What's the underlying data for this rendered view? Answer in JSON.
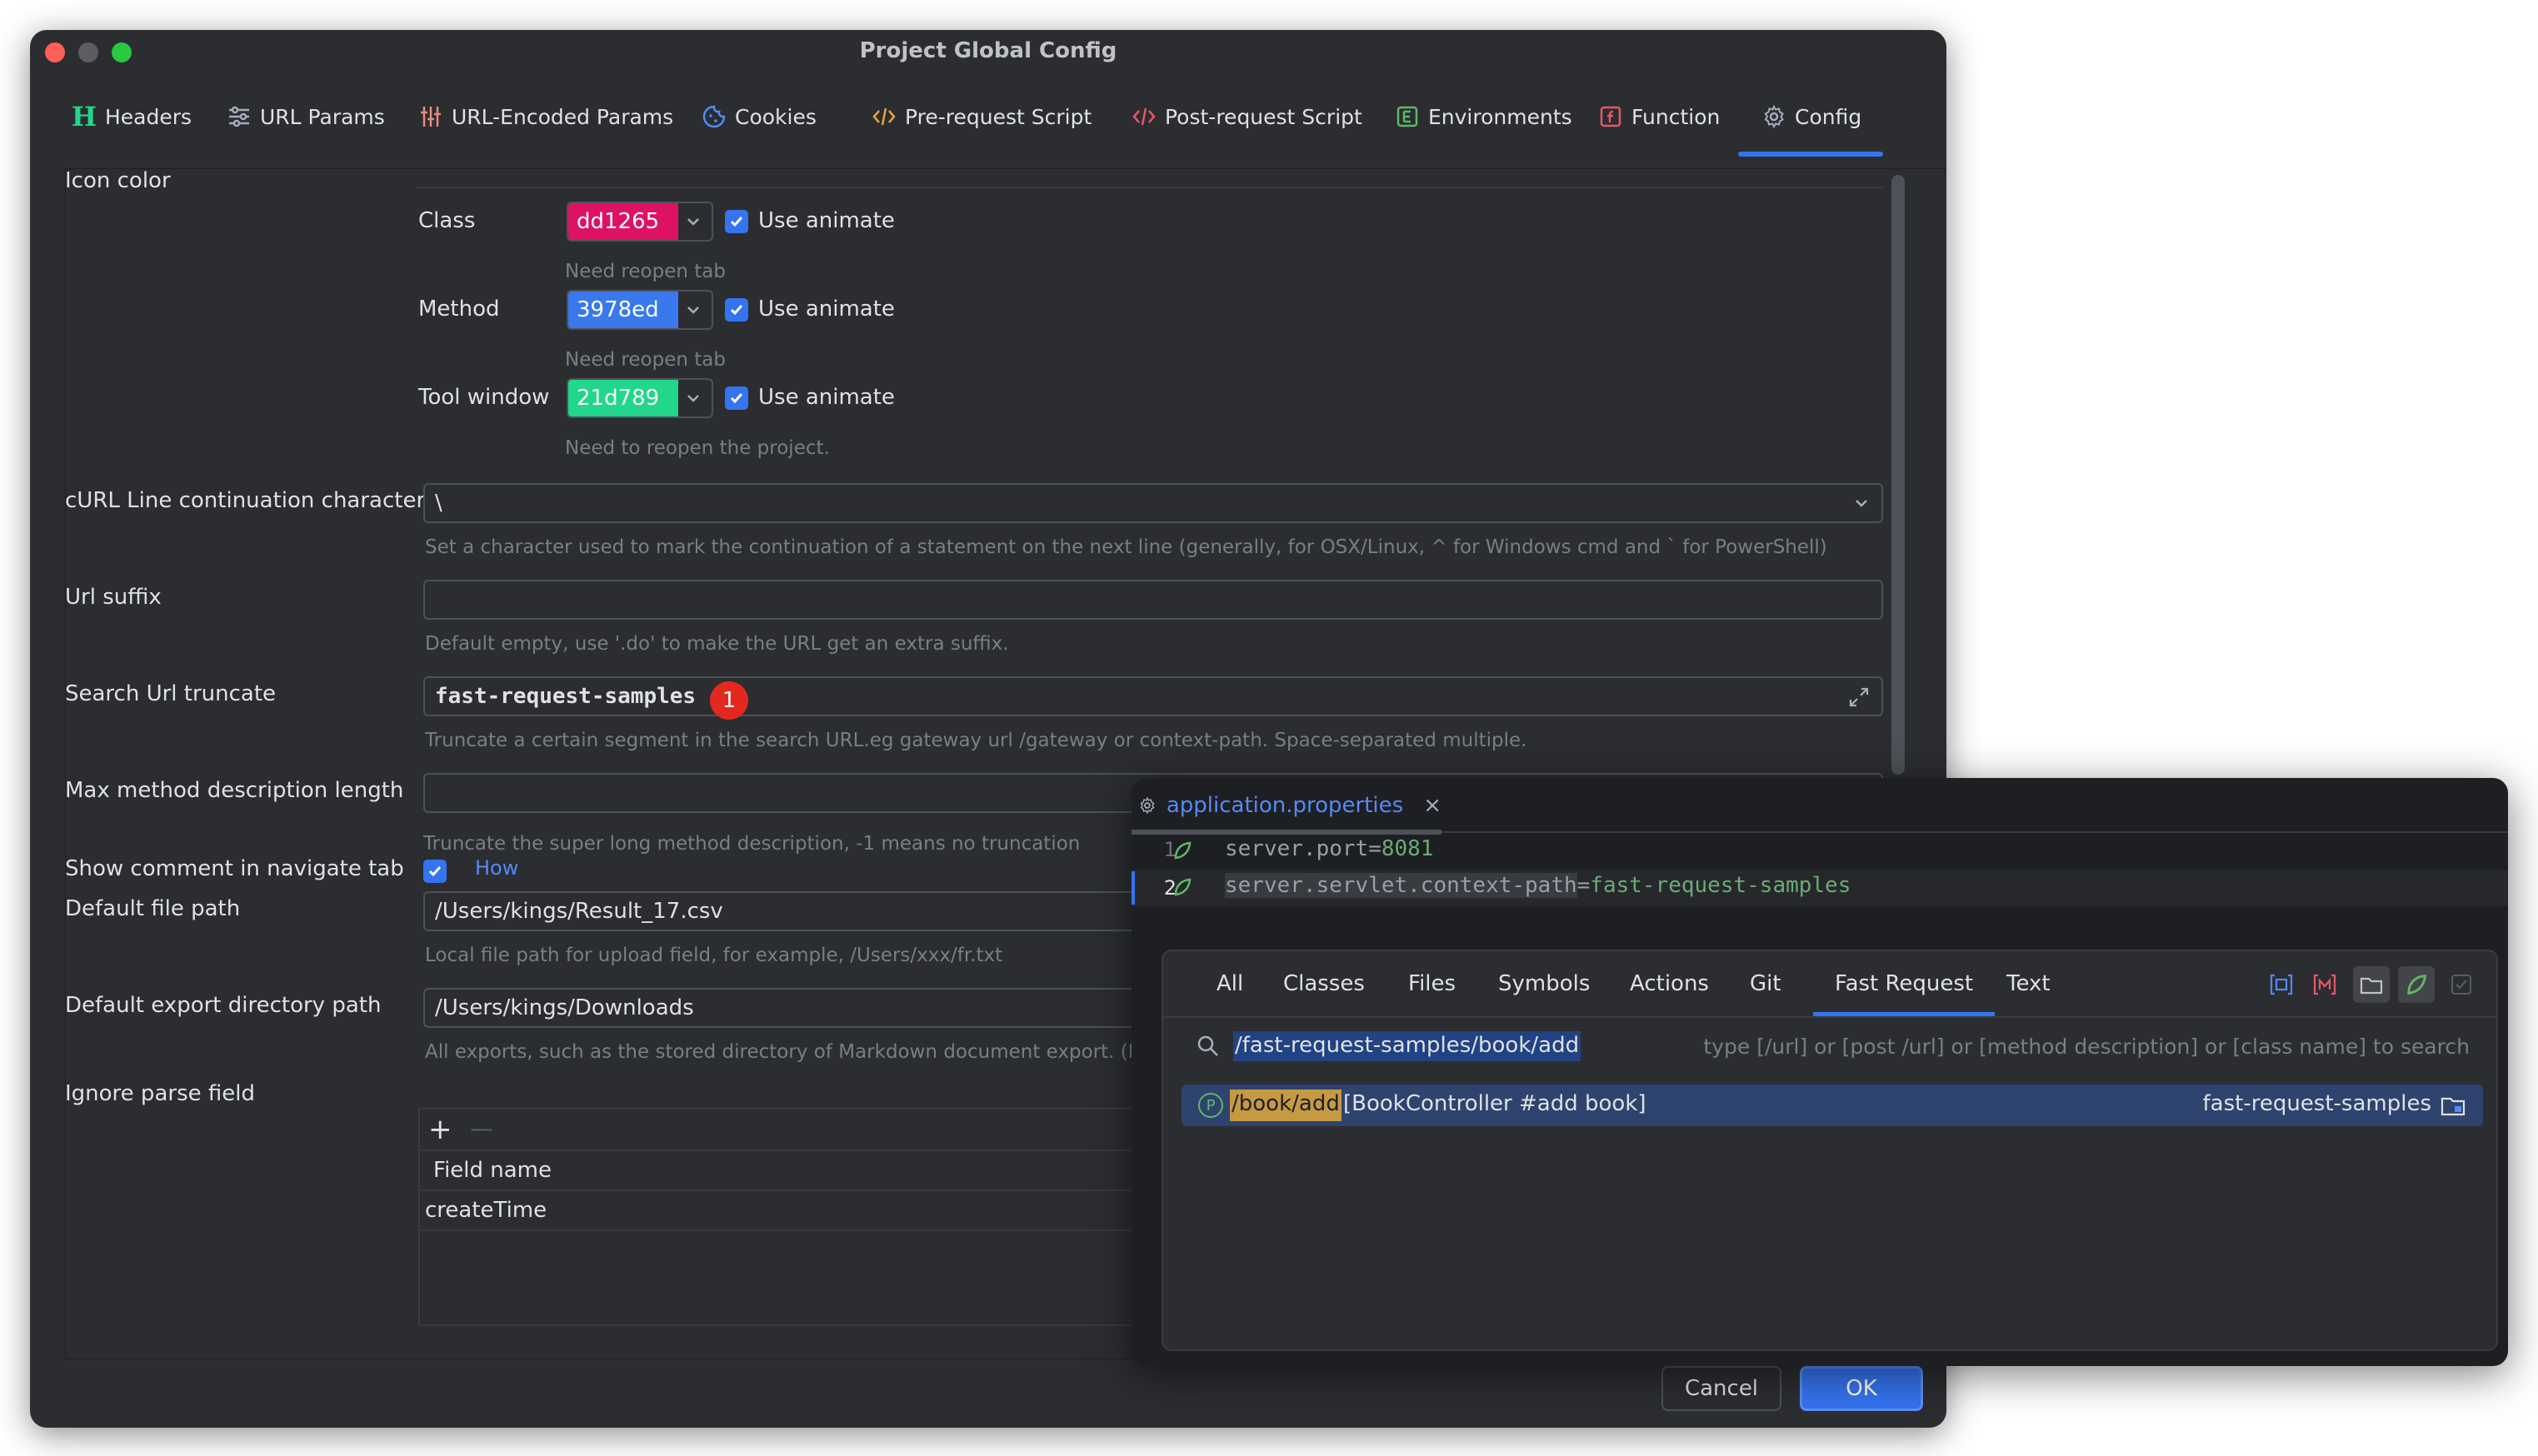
{
  "window": {
    "title": "Project Global Config"
  },
  "tabs": [
    {
      "label": "Headers",
      "icon": "h-icon"
    },
    {
      "label": "URL Params",
      "icon": "sliders-icon"
    },
    {
      "label": "URL-Encoded Params",
      "icon": "equalizer-icon"
    },
    {
      "label": "Cookies",
      "icon": "cookie-icon"
    },
    {
      "label": "Pre-request Script",
      "icon": "code-icon"
    },
    {
      "label": "Post-request Script",
      "icon": "code-icon"
    },
    {
      "label": "Environments",
      "icon": "env-icon"
    },
    {
      "label": "Function",
      "icon": "function-icon"
    },
    {
      "label": "Config",
      "icon": "gear-icon"
    }
  ],
  "active_tab": "Config",
  "config": {
    "icon_color_label": "Icon color",
    "class": {
      "label": "Class",
      "value": "dd1265",
      "color": "#dd1265",
      "animate_label": "Use animate",
      "animate": true,
      "hint": "Need reopen tab"
    },
    "method": {
      "label": "Method",
      "value": "3978ed",
      "color": "#3978ed",
      "animate_label": "Use animate",
      "animate": true,
      "hint": "Need reopen tab"
    },
    "tool_window": {
      "label": "Tool window",
      "value": "21d789",
      "color": "#21d789",
      "animate_label": "Use animate",
      "animate": true,
      "hint": "Need to reopen the project."
    },
    "curl": {
      "label": "cURL Line continuation character",
      "value": "\\",
      "hint": "Set a character used to mark the continuation of a statement on the next line (generally, for OSX/Linux, ^ for Windows cmd and ` for PowerShell)"
    },
    "url_suffix": {
      "label": "Url suffix",
      "value": "",
      "hint": "Default empty, use '.do' to make the URL get an extra suffix."
    },
    "search_url_truncate": {
      "label": "Search Url truncate",
      "value": "fast-request-samples",
      "badge": "1",
      "hint": "Truncate a certain segment in the search URL.eg gateway url /gateway or context-path. Space-separated multiple."
    },
    "max_method_desc": {
      "label": "Max method description length",
      "value": "",
      "hint": "Truncate the super long method description, -1 means no truncation"
    },
    "show_comment": {
      "label": "Show comment in navigate tab",
      "checked": true,
      "link": "How"
    },
    "default_file_path": {
      "label": "Default file path",
      "value": "/Users/kings/Result_17.csv",
      "hint": "Local file path for upload field, for example, /Users/xxx/fr.txt"
    },
    "default_export_dir": {
      "label": "Default export directory path",
      "value": "/Users/kings/Downloads",
      "hint": "All exports, such as the stored directory of Markdown document export. (M"
    },
    "ignore_parse_field": {
      "label": "Ignore parse field",
      "add": "+",
      "remove": "—",
      "column": "Field name",
      "rows": [
        "createTime"
      ]
    }
  },
  "popup": {
    "file_tab": "application.properties",
    "close": "×",
    "lines": [
      {
        "num": "1",
        "key": "server.port",
        "eq": "=",
        "value": "8081"
      },
      {
        "num": "2",
        "key": "server.servlet.context-path",
        "eq": "=",
        "value": "fast-request-samples"
      }
    ],
    "search_tabs": [
      "All",
      "Classes",
      "Files",
      "Symbols",
      "Actions",
      "Git",
      "Fast Request",
      "Text"
    ],
    "active_search_tab": "Fast Request",
    "query": "/fast-request-samples/book/add",
    "search_hint": "type [/url] or [post /url] or [method description] or [class name] to search",
    "result": {
      "badge": "P",
      "path": "/book/add",
      "desc": "[BookController #add book]",
      "module": "fast-request-samples"
    }
  },
  "footer": {
    "cancel": "Cancel",
    "ok": "OK"
  },
  "colors": {
    "accent": "#3574f0",
    "background": "#2b2d30",
    "badge": "#e5281f",
    "highlight": "#c59a42"
  }
}
